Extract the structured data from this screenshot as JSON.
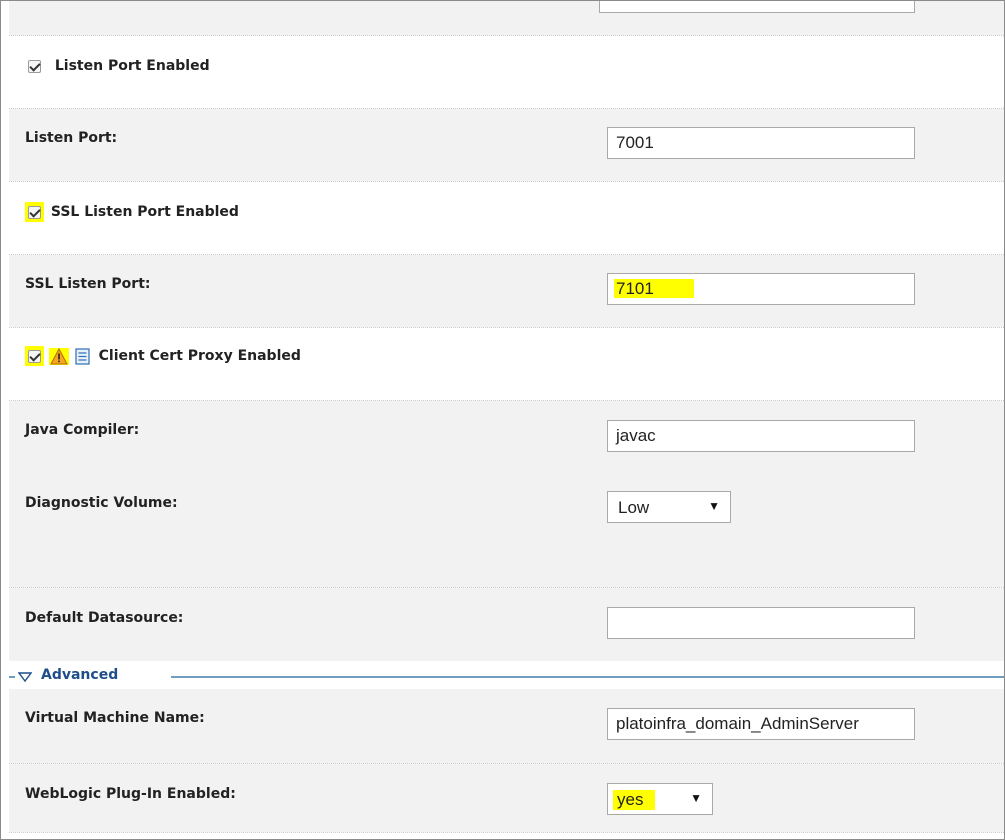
{
  "settings": {
    "listen_port_enabled_label": "Listen Port Enabled",
    "listen_port_label": "Listen Port:",
    "listen_port_value": "7001",
    "ssl_listen_port_enabled_label": "SSL Listen Port Enabled",
    "ssl_listen_port_label": "SSL Listen Port:",
    "ssl_listen_port_value": "7101",
    "client_cert_proxy_label": "Client Cert Proxy Enabled",
    "java_compiler_label": "Java Compiler:",
    "java_compiler_value": "javac",
    "diagnostic_volume_label": "Diagnostic Volume:",
    "diagnostic_volume_value": "Low",
    "default_datasource_label": "Default Datasource:",
    "default_datasource_value": ""
  },
  "advanced": {
    "section_label": "Advanced",
    "virtual_machine_name_label": "Virtual Machine Name:",
    "virtual_machine_name_value": "platoinfra_domain_AdminServer",
    "weblogic_plugin_label": "WebLogic Plug-In Enabled:",
    "weblogic_plugin_value": "yes"
  },
  "icons": {
    "checkbox": "checkbox-checked-icon",
    "warning": "warning-icon",
    "config": "document-icon",
    "dropdown": "dropdown-arrow-icon",
    "collapse": "collapse-triangle-icon"
  },
  "colors": {
    "highlight": "#ffff00",
    "shaded_row": "#f2f2f2",
    "advanced_text": "#1f4e8a",
    "advanced_line": "#6f9dbf"
  }
}
